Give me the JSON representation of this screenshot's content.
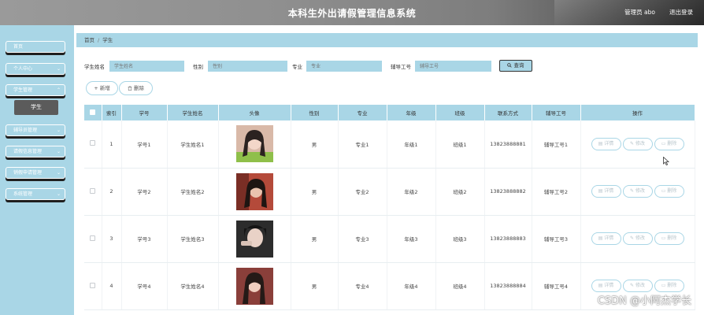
{
  "header": {
    "title": "本科生外出请假管理信息系统",
    "user": "管理员 abo",
    "logout": "退出登录"
  },
  "sidebar": {
    "items": [
      {
        "label": "首页",
        "chevron": ""
      },
      {
        "label": "个人中心",
        "chevron": "⌄"
      },
      {
        "label": "学生管理",
        "chevron": "⌃"
      },
      {
        "label": "辅导员管理",
        "chevron": "⌄"
      },
      {
        "label": "请假信息管理",
        "chevron": "⌄"
      },
      {
        "label": "销假申请管理",
        "chevron": "⌄"
      },
      {
        "label": "系统管理",
        "chevron": "⌄"
      }
    ],
    "active_sub": "学生"
  },
  "breadcrumb": {
    "home": "首页",
    "separator": "/",
    "current": "学生"
  },
  "search": {
    "student_name_label": "学生姓名",
    "student_name_placeholder": "学生姓名",
    "gender_label": "性别",
    "gender_placeholder": "性别",
    "major_label": "专业",
    "major_placeholder": "专业",
    "counselor_id_label": "辅导工号",
    "counselor_id_placeholder": "辅导工号",
    "query_label": "查询"
  },
  "actions": {
    "add_label": "+ 新增",
    "delete_label": "删除"
  },
  "table": {
    "columns": [
      "索引",
      "学号",
      "学生姓名",
      "头像",
      "性别",
      "专业",
      "年级",
      "班级",
      "联系方式",
      "辅导工号",
      "操作"
    ],
    "rows": [
      {
        "index": "1",
        "sid": "学号1",
        "name": "学生姓名1",
        "gender": "男",
        "major": "专业1",
        "grade": "年级1",
        "class": "班级1",
        "phone": "13823888881",
        "counselor": "辅导工号1"
      },
      {
        "index": "2",
        "sid": "学号2",
        "name": "学生姓名2",
        "gender": "男",
        "major": "专业2",
        "grade": "年级2",
        "class": "班级2",
        "phone": "13823888882",
        "counselor": "辅导工号2"
      },
      {
        "index": "3",
        "sid": "学号3",
        "name": "学生姓名3",
        "gender": "男",
        "major": "专业3",
        "grade": "年级3",
        "class": "班级3",
        "phone": "13823888883",
        "counselor": "辅导工号3"
      },
      {
        "index": "4",
        "sid": "学号4",
        "name": "学生姓名4",
        "gender": "男",
        "major": "专业4",
        "grade": "年级4",
        "class": "班级4",
        "phone": "13823888884",
        "counselor": "辅导工号4"
      }
    ],
    "op_buttons": [
      "详情",
      "修改",
      "删除"
    ]
  },
  "watermark": "CSDN @小阿杰学长",
  "colors": {
    "accent": "#a9d6e6",
    "active_sub_bg": "#5b5b5b"
  }
}
